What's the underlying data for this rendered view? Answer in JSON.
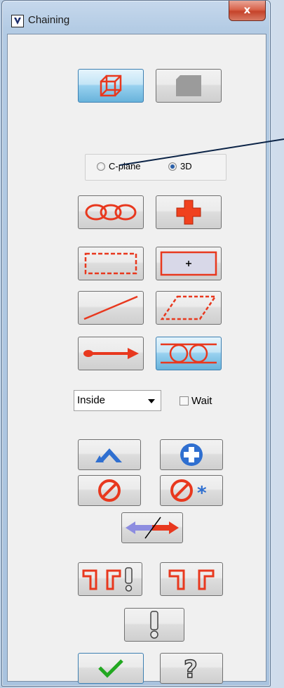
{
  "window": {
    "title": "Chaining",
    "close_label": "x"
  },
  "chain_mode": {
    "options": [
      "C-plane",
      "3D"
    ],
    "selected": "3D"
  },
  "dropdown": {
    "value": "Inside"
  },
  "wait_checkbox": {
    "label": "Wait",
    "checked": false
  },
  "buttons": [
    {
      "id": "wireframe",
      "icon": "wireframe-cube-icon",
      "active": true
    },
    {
      "id": "solid",
      "icon": "solid-face-icon",
      "active": false
    },
    {
      "id": "chain",
      "icon": "chain-links-icon",
      "active": false
    },
    {
      "id": "point",
      "icon": "red-cross-icon",
      "active": false
    },
    {
      "id": "window",
      "icon": "dashed-window-icon",
      "active": false
    },
    {
      "id": "area",
      "icon": "area-box-icon",
      "active": false
    },
    {
      "id": "single",
      "icon": "single-line-icon",
      "active": false
    },
    {
      "id": "polygon",
      "icon": "dashed-parallelogram-icon",
      "active": false
    },
    {
      "id": "vector",
      "icon": "arrow-vector-icon",
      "active": false
    },
    {
      "id": "partial",
      "icon": "partial-chain-icon",
      "active": true
    },
    {
      "id": "last",
      "icon": "back-arrow-icon",
      "active": false
    },
    {
      "id": "select-all",
      "icon": "plus-circle-icon",
      "active": false
    },
    {
      "id": "unselect",
      "icon": "prohibit-icon",
      "active": false
    },
    {
      "id": "unselect-all",
      "icon": "prohibit-star-icon",
      "active": false
    },
    {
      "id": "reverse",
      "icon": "reverse-arrows-icon",
      "active": false
    },
    {
      "id": "options-warn",
      "icon": "chain-options-warning-icon",
      "active": false
    },
    {
      "id": "options",
      "icon": "chain-options-icon",
      "active": false
    },
    {
      "id": "info",
      "icon": "info-exclamation-icon",
      "active": false
    },
    {
      "id": "ok",
      "icon": "checkmark-icon",
      "active": false
    },
    {
      "id": "help",
      "icon": "question-icon",
      "active": false
    }
  ]
}
